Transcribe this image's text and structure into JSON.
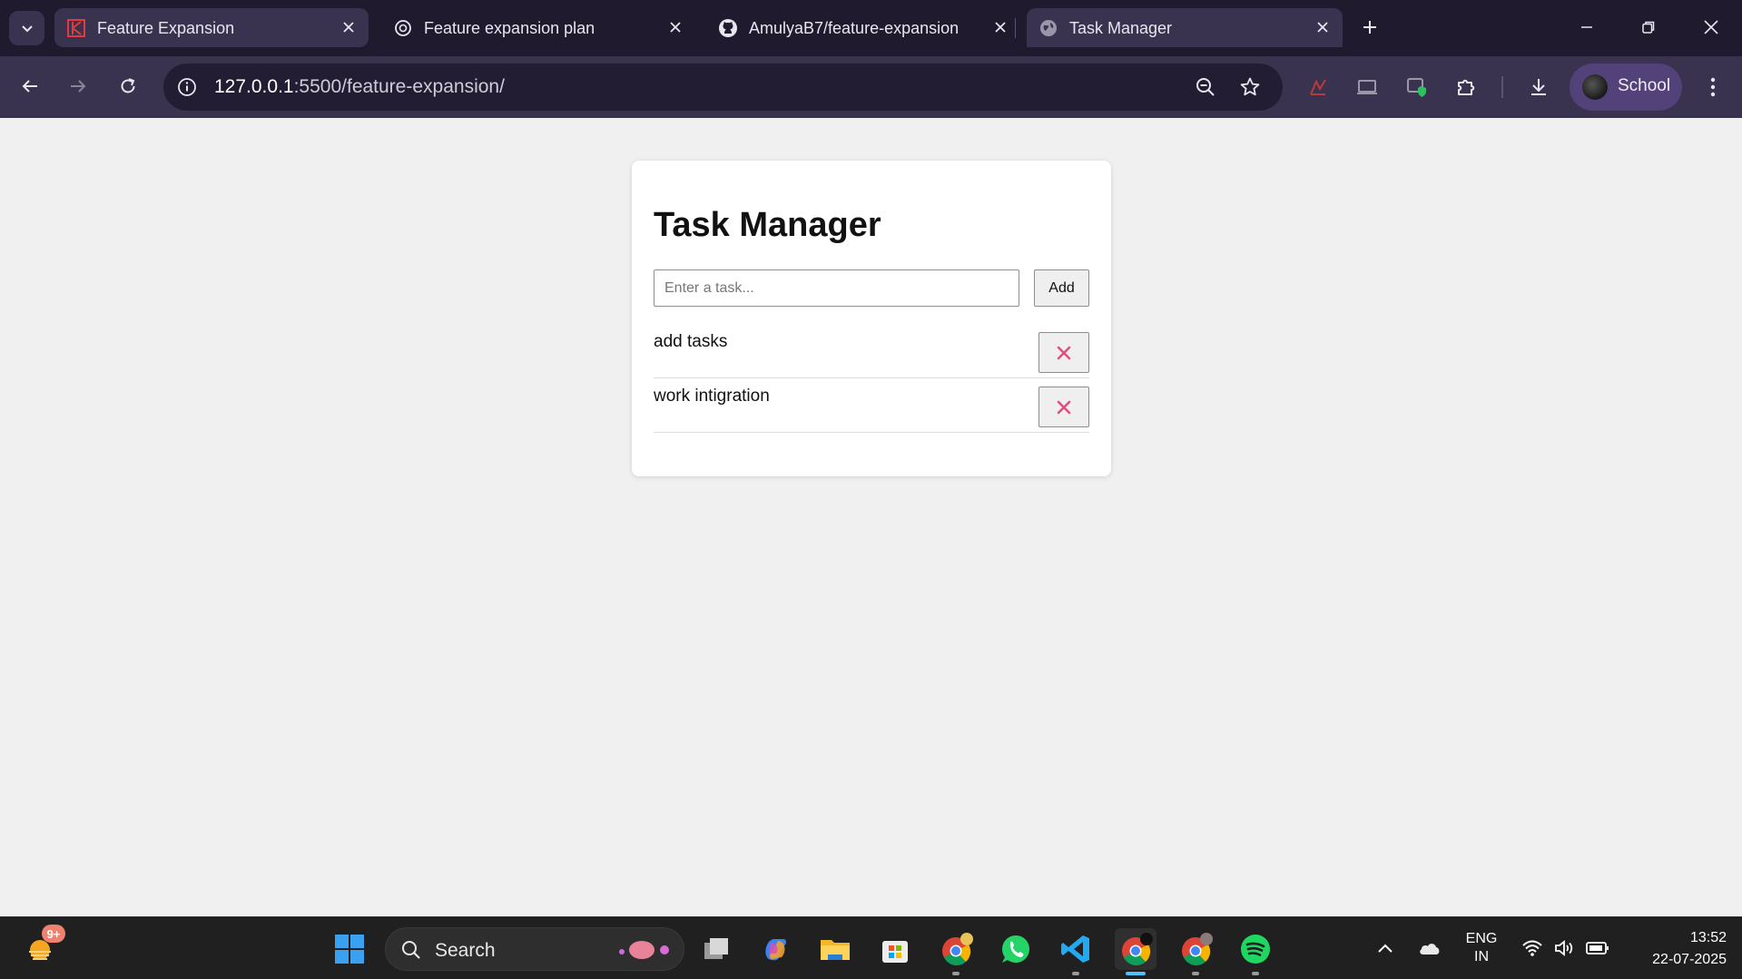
{
  "browser": {
    "tabs": [
      {
        "title": "Feature Expansion",
        "favicon": "red-k-icon"
      },
      {
        "title": "Feature expansion plan",
        "favicon": "openai-icon"
      },
      {
        "title": "AmulyaB7/feature-expansion",
        "favicon": "github-icon"
      },
      {
        "title": "Task Manager",
        "favicon": "globe-icon",
        "active": true
      }
    ],
    "url_host": "127.0.0.1",
    "url_path": ":5500/feature-expansion/",
    "profile_name": "School"
  },
  "page": {
    "title": "Task Manager",
    "input_placeholder": "Enter a task...",
    "add_label": "Add",
    "tasks": [
      {
        "text": "add tasks"
      },
      {
        "text": "work intigration"
      }
    ],
    "delete_color": "#e0507a"
  },
  "taskbar": {
    "weather_badge": "9+",
    "search_label": "Search",
    "lang_line1": "ENG",
    "lang_line2": "IN",
    "time": "13:52",
    "date": "22-07-2025"
  }
}
